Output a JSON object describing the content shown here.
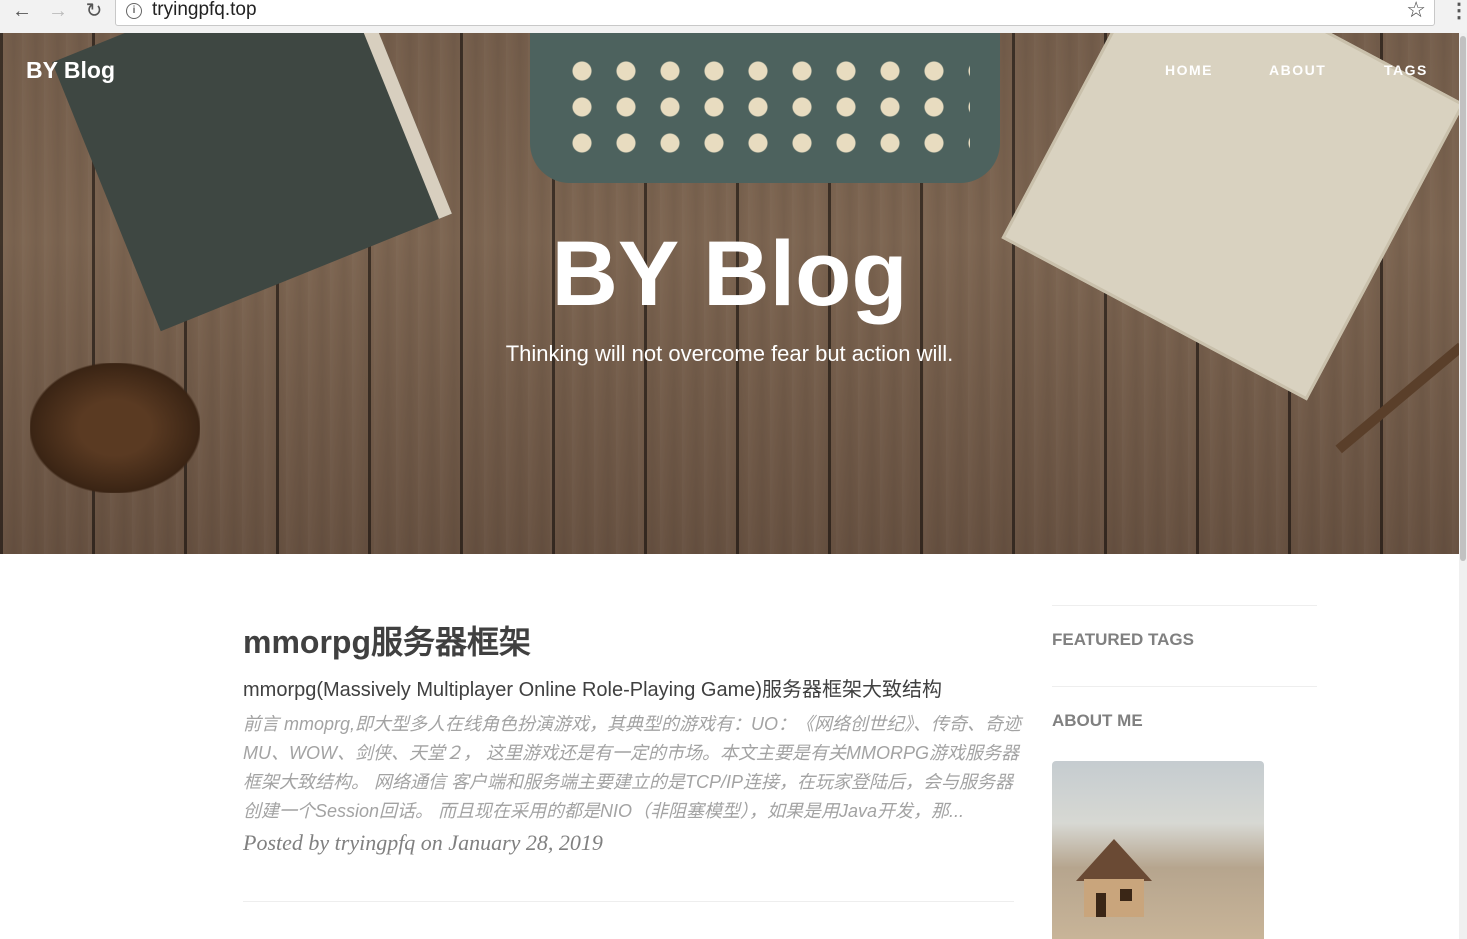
{
  "browser": {
    "url": "tryingpfq.top",
    "back_icon": "←",
    "forward_icon": "→",
    "reload_icon": "↻",
    "info_icon": "i",
    "star_icon": "☆",
    "menu_icon": "⋮"
  },
  "header": {
    "brand": "BY Blog",
    "nav": [
      "HOME",
      "ABOUT",
      "TAGS"
    ]
  },
  "hero": {
    "title": "BY Blog",
    "subtitle": "Thinking will not overcome fear but action will."
  },
  "post": {
    "title": "mmorpg服务器框架",
    "subtitle": "mmorpg(Massively Multiplayer Online Role-Playing Game)服务器框架大致结构",
    "excerpt": "前言 mmoprg,即大型多人在线角色扮演游戏，其典型的游戏有：UO：《网络创世纪》、传奇、奇迹MU、WOW、剑侠、天堂２，  这里游戏还是有一定的市场。本文主要是有关MMORPG游戏服务器框架大致结构。 网络通信 客户端和服务端主要建立的是TCP/IP连接，在玩家登陆后，会与服务器创建一个Session回话。 而且现在采用的都是NIO（非阻塞模型），如果是用Java开发，那...",
    "meta": "Posted by tryingpfq on January 28, 2019"
  },
  "sidebar": {
    "featured_tags_title": "FEATURED TAGS",
    "about_me_title": "ABOUT ME"
  }
}
